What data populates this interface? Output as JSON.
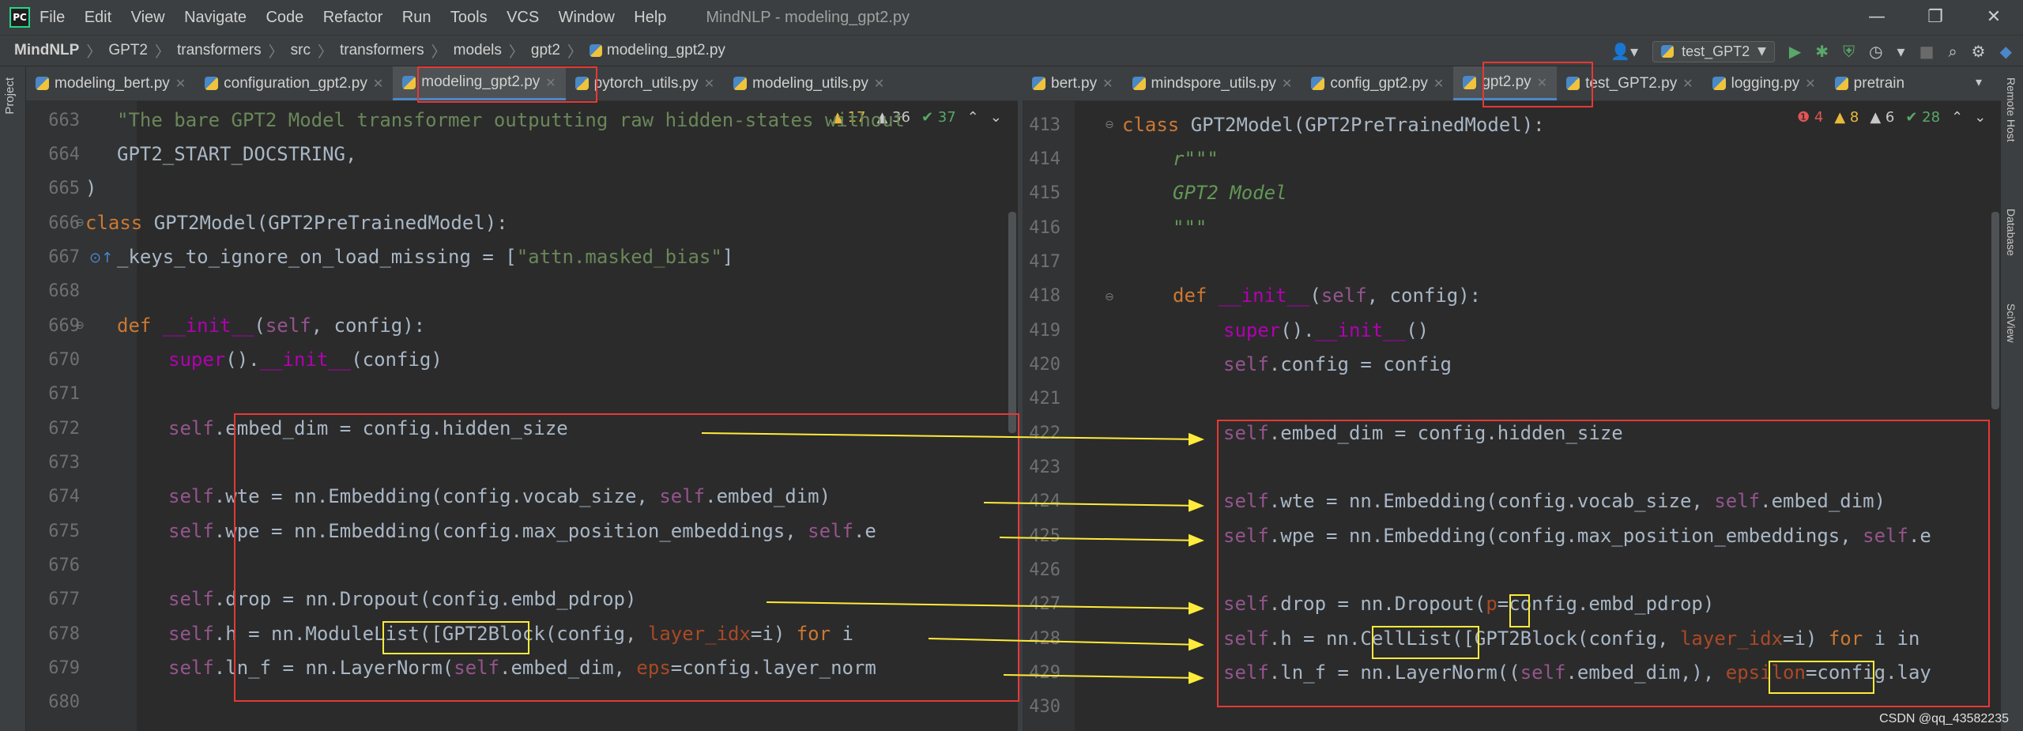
{
  "titlebar": {
    "logo": "PC",
    "menu": [
      "File",
      "Edit",
      "View",
      "Navigate",
      "Code",
      "Refactor",
      "Run",
      "Tools",
      "VCS",
      "Window",
      "Help"
    ],
    "title": "MindNLP - modeling_gpt2.py",
    "controls": [
      "—",
      "❐",
      "✕"
    ]
  },
  "breadcrumb": [
    "MindNLP",
    "GPT2",
    "transformers",
    "src",
    "transformers",
    "models",
    "gpt2",
    "modeling_gpt2.py"
  ],
  "run_config": "test_GPT2",
  "left_strip": "Project",
  "right_strip": [
    "Remote Host",
    "Database",
    "SciView"
  ],
  "left_tabs": [
    {
      "label": "modeling_bert.py",
      "active": false
    },
    {
      "label": "configuration_gpt2.py",
      "active": false
    },
    {
      "label": "modeling_gpt2.py",
      "active": true
    },
    {
      "label": "pytorch_utils.py",
      "active": false
    },
    {
      "label": "modeling_utils.py",
      "active": false
    }
  ],
  "right_tabs": [
    {
      "label": "bert.py",
      "active": false
    },
    {
      "label": "mindspore_utils.py",
      "active": false
    },
    {
      "label": "config_gpt2.py",
      "active": false
    },
    {
      "label": "gpt2.py",
      "active": true
    },
    {
      "label": "test_GPT2.py",
      "active": false
    },
    {
      "label": "logging.py",
      "active": false
    },
    {
      "label": "pretrain",
      "active": false
    }
  ],
  "left_inspections": [
    "▲ 17",
    "▲ 36",
    "✔ 37"
  ],
  "right_inspections": [
    "❶ 4",
    "▲ 8",
    "▲ 6",
    "✔ 28"
  ],
  "left_lines": [
    "663",
    "664",
    "665",
    "666",
    "667",
    "668",
    "669",
    "670",
    "671",
    "672",
    "673",
    "674",
    "675",
    "676",
    "677",
    "678",
    "679",
    "680"
  ],
  "right_lines": [
    "413",
    "414",
    "415",
    "416",
    "417",
    "418",
    "419",
    "420",
    "421",
    "422",
    "423",
    "424",
    "425",
    "426",
    "427",
    "428",
    "429",
    "430"
  ],
  "watermark": "CSDN @qq_43582235",
  "colors": {
    "red_box": "#e53935",
    "yellow_box": "#ffeb3b",
    "arrow": "#ffeb3b"
  }
}
